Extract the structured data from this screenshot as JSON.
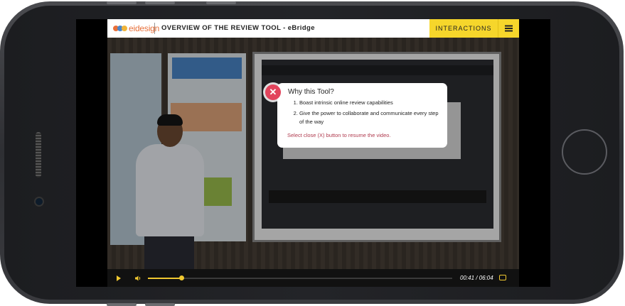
{
  "header": {
    "logo_text": "eidesign",
    "title": "OVERVIEW OF THE REVIEW TOOL - eBridge",
    "interactions_label": "INTERACTIONS"
  },
  "popup": {
    "title": "Why this Tool?",
    "items": [
      "Boast intrinsic online review capabilities",
      "Give the power to collaborate and communicate every step of the way"
    ],
    "note": "Select close (X) button to resume the video."
  },
  "player": {
    "time_display": "00:41 / 06:04",
    "progress_fraction": 0.11
  },
  "colors": {
    "accent": "#f6d62b",
    "close": "#e2445c",
    "note": "#b03a4e",
    "logo_dot_1": "#e8703a",
    "logo_dot_2": "#4a86c9"
  },
  "icons": [
    "menu-icon",
    "close-icon",
    "play-icon",
    "volume-icon",
    "captions-icon"
  ]
}
